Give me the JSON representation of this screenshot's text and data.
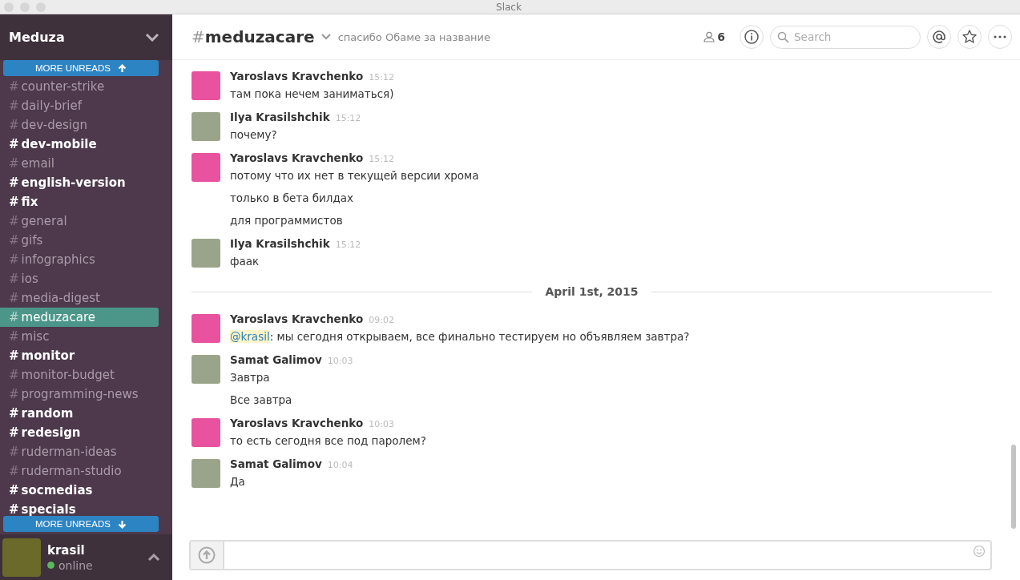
{
  "window": {
    "title": "Slack"
  },
  "sidebar": {
    "team": "Meduza",
    "more_unreads_top": "MORE UNREADS",
    "more_unreads_bottom": "MORE UNREADS",
    "channels": [
      {
        "hash": "#",
        "name": "counter-strike",
        "unread": false,
        "selected": false
      },
      {
        "hash": "#",
        "name": "daily-brief",
        "unread": false,
        "selected": false
      },
      {
        "hash": "#",
        "name": "dev-design",
        "unread": false,
        "selected": false
      },
      {
        "hash": "#",
        "name": "dev-mobile",
        "unread": true,
        "selected": false
      },
      {
        "hash": "#",
        "name": "email",
        "unread": false,
        "selected": false
      },
      {
        "hash": "#",
        "name": "english-version",
        "unread": true,
        "selected": false
      },
      {
        "hash": "#",
        "name": "fix",
        "unread": true,
        "selected": false
      },
      {
        "hash": "#",
        "name": "general",
        "unread": false,
        "selected": false
      },
      {
        "hash": "#",
        "name": "gifs",
        "unread": false,
        "selected": false
      },
      {
        "hash": "#",
        "name": "infographics",
        "unread": false,
        "selected": false
      },
      {
        "hash": "#",
        "name": "ios",
        "unread": false,
        "selected": false
      },
      {
        "hash": "#",
        "name": "media-digest",
        "unread": false,
        "selected": false
      },
      {
        "hash": "#",
        "name": "meduzacare",
        "unread": false,
        "selected": true
      },
      {
        "hash": "#",
        "name": "misc",
        "unread": false,
        "selected": false
      },
      {
        "hash": "#",
        "name": "monitor",
        "unread": true,
        "selected": false
      },
      {
        "hash": "#",
        "name": "monitor-budget",
        "unread": false,
        "selected": false
      },
      {
        "hash": "#",
        "name": "programming-news",
        "unread": false,
        "selected": false
      },
      {
        "hash": "#",
        "name": "random",
        "unread": true,
        "selected": false
      },
      {
        "hash": "#",
        "name": "redesign",
        "unread": true,
        "selected": false
      },
      {
        "hash": "#",
        "name": "ruderman-ideas",
        "unread": false,
        "selected": false
      },
      {
        "hash": "#",
        "name": "ruderman-studio",
        "unread": false,
        "selected": false
      },
      {
        "hash": "#",
        "name": "socmedias",
        "unread": true,
        "selected": false
      },
      {
        "hash": "#",
        "name": "specials",
        "unread": true,
        "selected": false
      }
    ],
    "user": {
      "name": "krasil",
      "status": "online",
      "online": true
    }
  },
  "header": {
    "hash": "#",
    "channel": "meduzacare",
    "topic": "спасибо Обаме за название",
    "members": "6",
    "search_placeholder": "Search"
  },
  "messages": [
    {
      "kind": "message",
      "author": "Yaroslavs Kravchenko",
      "time": "15:12",
      "avatar": {
        "kind": "blank"
      },
      "lines": [
        {
          "text": "там пока нечем заниматься)"
        }
      ]
    },
    {
      "kind": "message",
      "author": "Ilya Krasilshchik",
      "time": "15:12",
      "avatar": {
        "kind": "photo"
      },
      "lines": [
        {
          "text": "почему?"
        }
      ]
    },
    {
      "kind": "message",
      "author": "Yaroslavs Kravchenko",
      "time": "15:12",
      "avatar": {
        "kind": "blank"
      },
      "lines": [
        {
          "text": "потому что их нет в текущей версии хрома"
        },
        {
          "text": "только в бета билдах"
        },
        {
          "text": "для программистов"
        }
      ]
    },
    {
      "kind": "message",
      "author": "Ilya Krasilshchik",
      "time": "15:12",
      "avatar": {
        "kind": "photo"
      },
      "lines": [
        {
          "text": "фаак"
        }
      ]
    },
    {
      "kind": "divider",
      "label": "April 1st, 2015"
    },
    {
      "kind": "message",
      "author": "Yaroslavs Kravchenko",
      "time": "09:02",
      "avatar": {
        "kind": "blank"
      },
      "lines": [
        {
          "mention": "@krasil",
          "text": ": мы сегодня открываем, все финально тестируем но объявляем завтра?"
        }
      ]
    },
    {
      "kind": "message",
      "author": "Samat Galimov",
      "time": "10:03",
      "avatar": {
        "kind": "photo"
      },
      "lines": [
        {
          "text": "Завтра"
        },
        {
          "text": "Все завтра"
        }
      ]
    },
    {
      "kind": "message",
      "author": "Yaroslavs Kravchenko",
      "time": "10:03",
      "avatar": {
        "kind": "blank"
      },
      "lines": [
        {
          "text": "то есть сегодня все под паролем?"
        }
      ]
    },
    {
      "kind": "message",
      "author": "Samat Galimov",
      "time": "10:04",
      "avatar": {
        "kind": "photo"
      },
      "lines": [
        {
          "text": "Да"
        }
      ]
    }
  ]
}
